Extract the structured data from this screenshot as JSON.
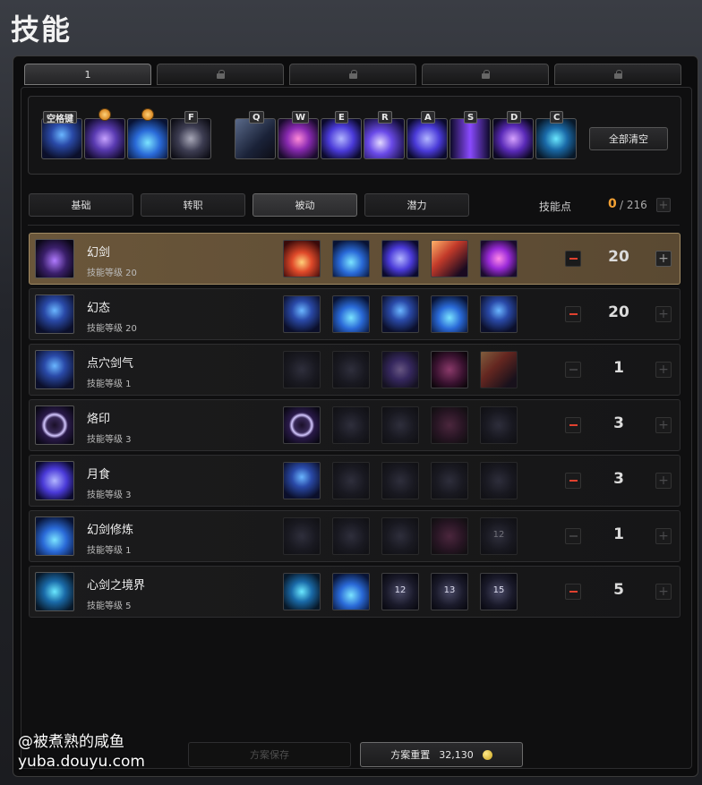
{
  "page_title": "技能",
  "tabs": [
    {
      "label": "1",
      "locked": false
    },
    {
      "label": "",
      "locked": true
    },
    {
      "label": "",
      "locked": true
    },
    {
      "label": "",
      "locked": true
    },
    {
      "label": "",
      "locked": true
    }
  ],
  "hotbar": {
    "slots": [
      {
        "key": "空格键",
        "badge": false
      },
      {
        "key": "",
        "badge": true
      },
      {
        "key": "",
        "badge": true
      },
      {
        "key": "F",
        "badge": false
      },
      {
        "key": "Q",
        "badge": false
      },
      {
        "key": "W",
        "badge": false
      },
      {
        "key": "E",
        "badge": false
      },
      {
        "key": "R",
        "badge": false
      },
      {
        "key": "A",
        "badge": false
      },
      {
        "key": "S",
        "badge": false
      },
      {
        "key": "D",
        "badge": false
      },
      {
        "key": "C",
        "badge": false
      }
    ],
    "clear_all_label": "全部清空"
  },
  "categories": [
    "基础",
    "转职",
    "被动",
    "潜力"
  ],
  "active_category": "被动",
  "skill_points": {
    "label": "技能点",
    "current": "0",
    "total": "/ 216"
  },
  "skills": [
    {
      "name": "幻剑",
      "level": "技能等级 20",
      "value": "20",
      "selected": true,
      "minus": true,
      "plus": true,
      "node_labels": [
        "",
        "",
        "",
        "",
        ""
      ],
      "icon": "phantom-sword-icon"
    },
    {
      "name": "幻态",
      "level": "技能等级 20",
      "value": "20",
      "selected": false,
      "minus": true,
      "plus": false,
      "node_labels": [
        "",
        "",
        "",
        "",
        ""
      ],
      "icon": "phantom-form-icon"
    },
    {
      "name": "点穴剑气",
      "level": "技能等级 1",
      "value": "1",
      "selected": false,
      "minus": false,
      "plus": false,
      "node_labels": [
        "",
        "",
        "",
        "",
        ""
      ],
      "icon": "acupoint-sword-qi-icon"
    },
    {
      "name": "烙印",
      "level": "技能等级 3",
      "value": "3",
      "selected": false,
      "minus": true,
      "plus": false,
      "node_labels": [
        "",
        "",
        "",
        "",
        ""
      ],
      "icon": "brand-icon"
    },
    {
      "name": "月食",
      "level": "技能等级 3",
      "value": "3",
      "selected": false,
      "minus": true,
      "plus": false,
      "node_labels": [
        "",
        "",
        "",
        "",
        ""
      ],
      "icon": "eclipse-icon"
    },
    {
      "name": "幻剑修炼",
      "level": "技能等级 1",
      "value": "1",
      "selected": false,
      "minus": false,
      "plus": false,
      "node_labels": [
        "",
        "",
        "",
        "",
        "12"
      ],
      "icon": "phantom-sword-training-icon"
    },
    {
      "name": "心剑之境界",
      "level": "技能等级 5",
      "value": "5",
      "selected": false,
      "minus": true,
      "plus": false,
      "node_labels": [
        "",
        "",
        "12",
        "13",
        "15"
      ],
      "icon": "heart-sword-realm-icon"
    }
  ],
  "footer": {
    "save_label": "方案保存",
    "reset_label": "方案重置",
    "reset_cost": "32,130"
  },
  "watermark": {
    "line1": "@被煮熟的咸鱼",
    "line2": "yuba.douyu.com"
  }
}
